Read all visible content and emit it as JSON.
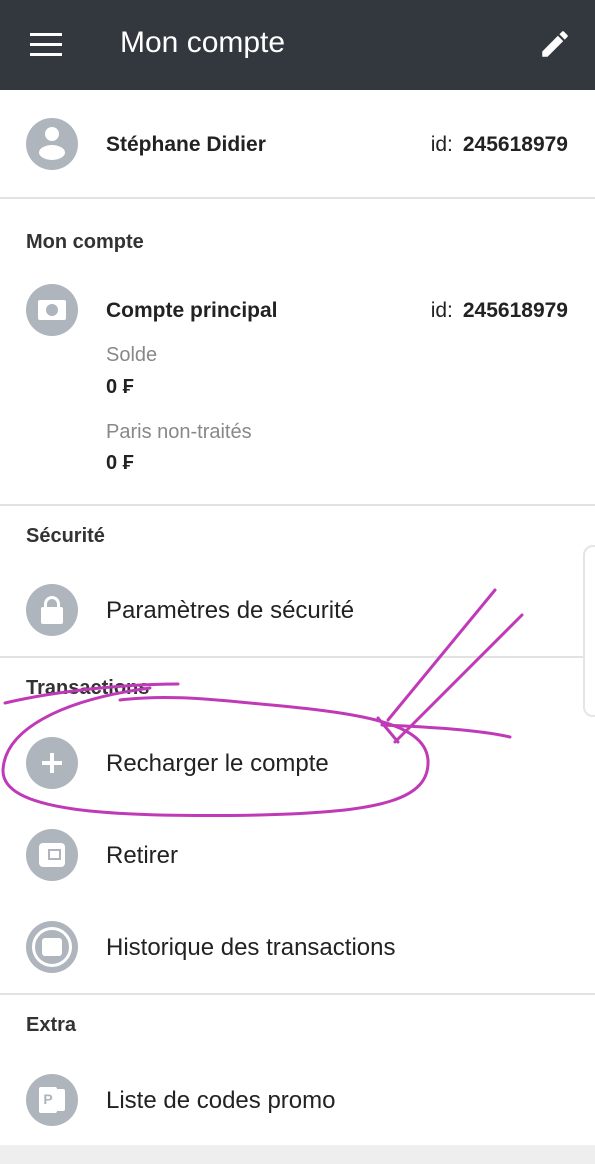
{
  "header": {
    "title": "Mon compte"
  },
  "user": {
    "name": "Stéphane Didier",
    "id_label": "id:",
    "id": "245618979"
  },
  "account_section": {
    "title": "Mon compte",
    "account_name": "Compte principal",
    "id_label": "id:",
    "id": "245618979",
    "balance_label": "Solde",
    "balance": "0 ₣",
    "pending_label": "Paris non-traités",
    "pending": "0 ₣"
  },
  "security": {
    "title": "Sécurité",
    "item": "Paramètres de sécurité"
  },
  "transactions": {
    "title": "Transactions",
    "items": [
      "Recharger le compte",
      "Retirer",
      "Historique des transactions"
    ]
  },
  "extra": {
    "title": "Extra",
    "item": "Liste de codes promo"
  },
  "colors": {
    "header": "#32383e",
    "icon": "#aeb5bd",
    "annotation": "#c03ab8"
  }
}
